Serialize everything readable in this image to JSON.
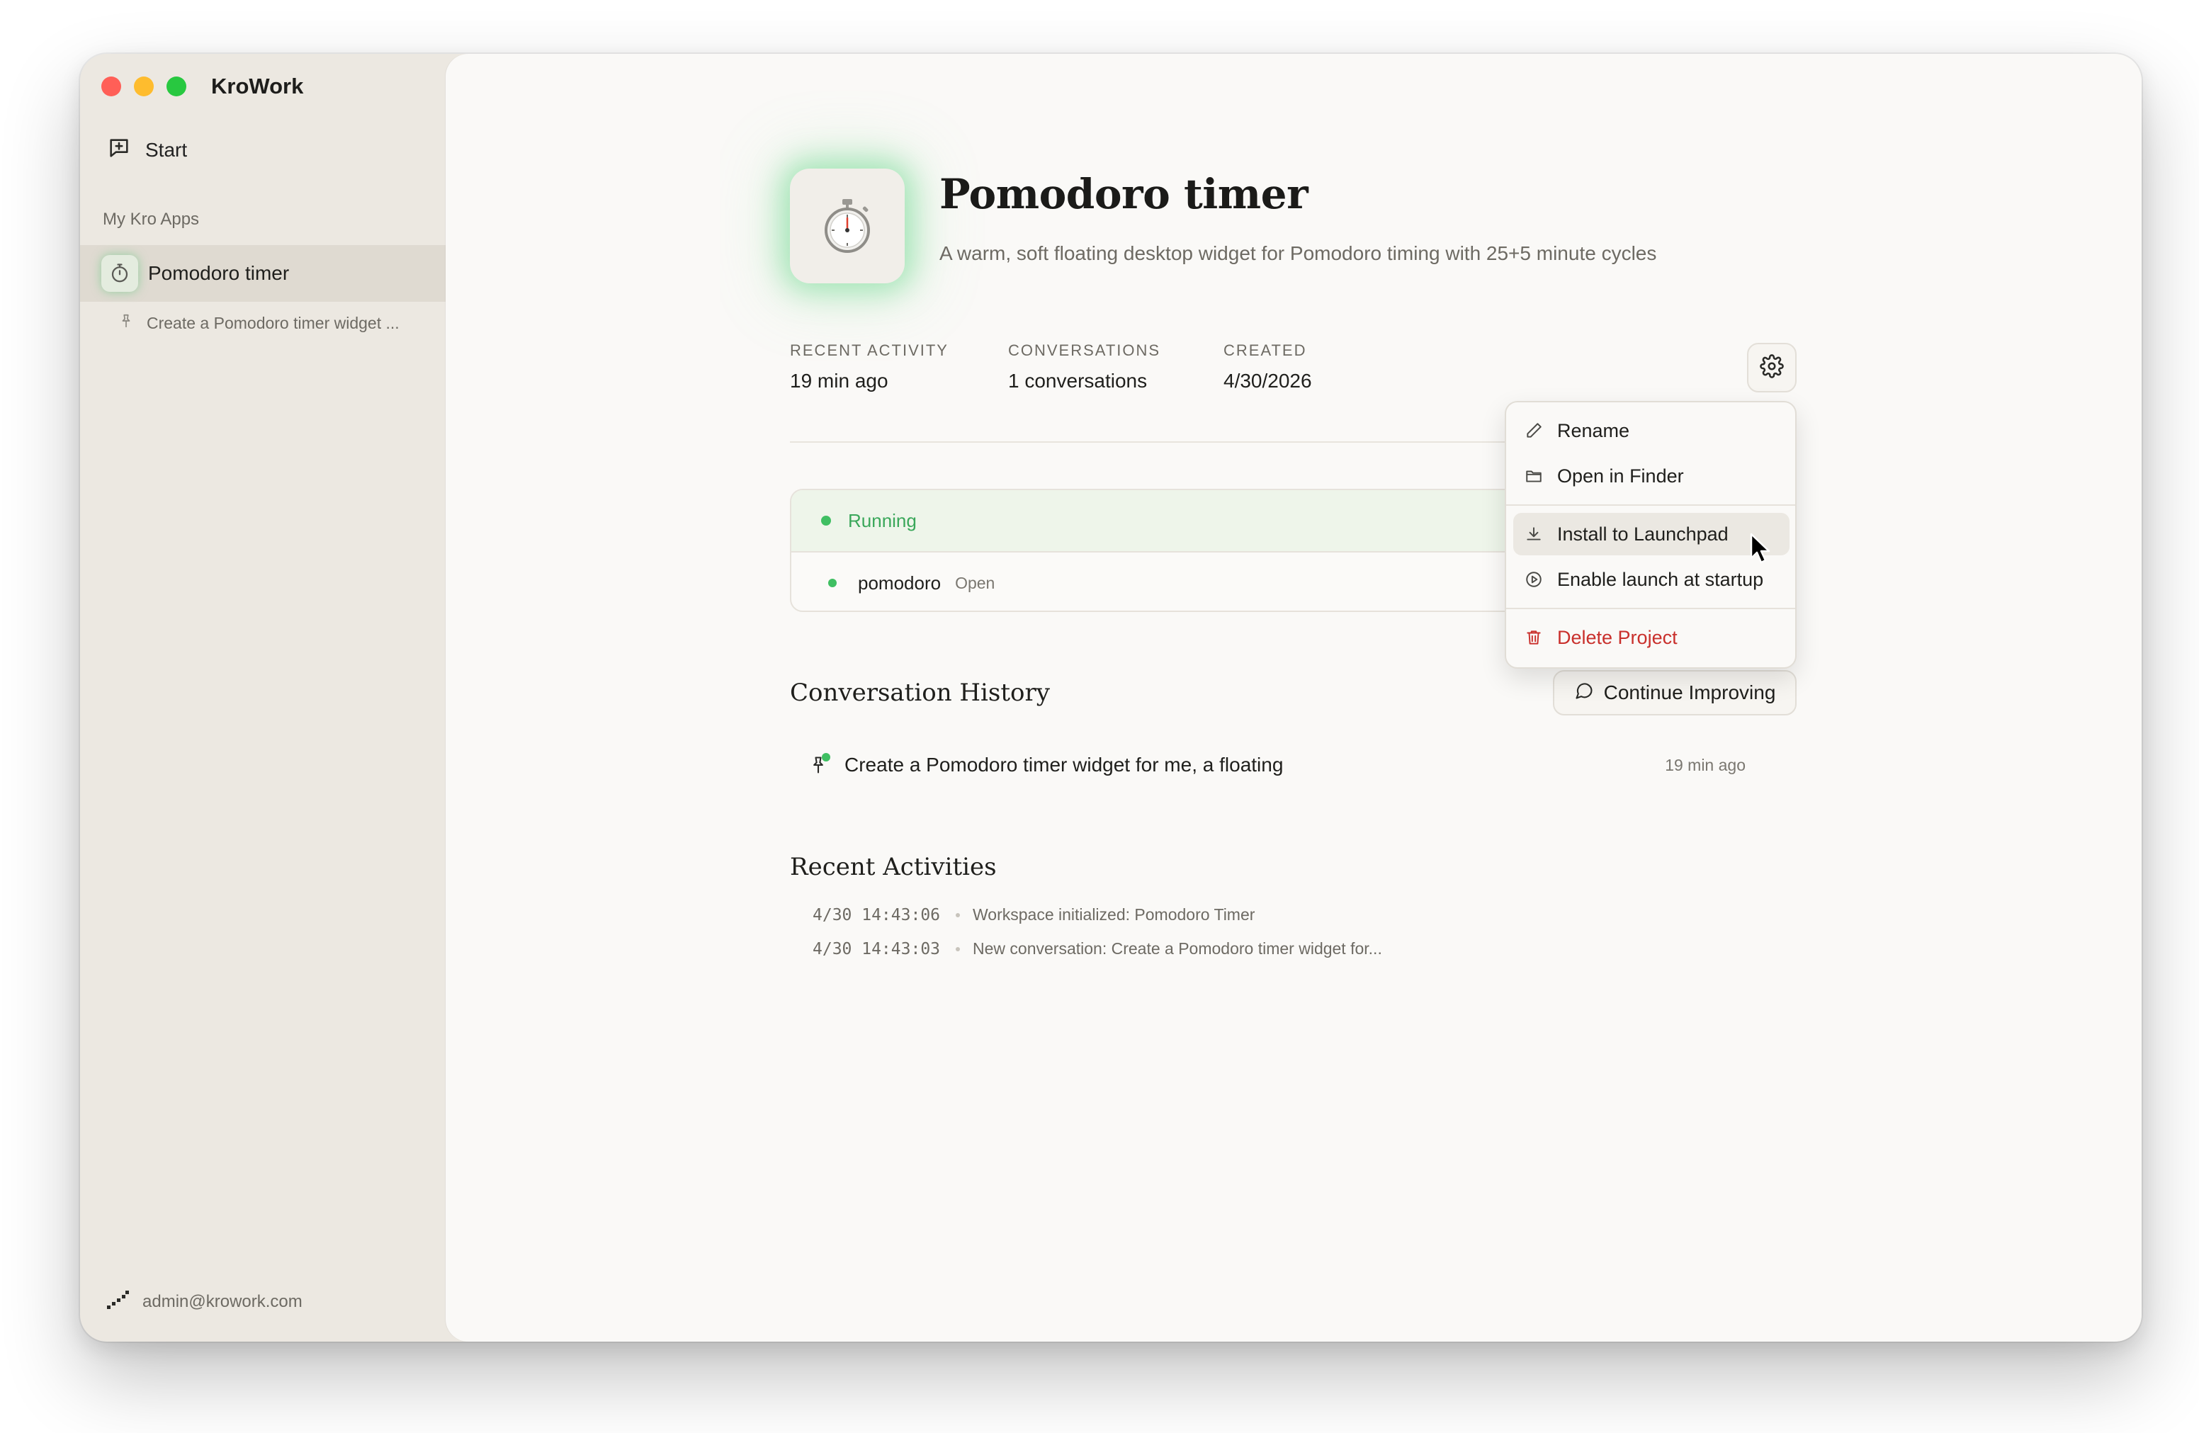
{
  "app": {
    "title": "KroWork"
  },
  "sidebar": {
    "start_label": "Start",
    "section_label": "My Kro Apps",
    "apps": [
      {
        "label": "Pomodoro timer"
      }
    ],
    "conversations": [
      {
        "label": "Create a Pomodoro timer widget ..."
      }
    ],
    "user_email": "admin@krowork.com"
  },
  "project": {
    "title": "Pomodoro timer",
    "description": "A warm, soft floating desktop widget for Pomodoro timing with 25+5 minute cycles",
    "stats": [
      {
        "label": "RECENT ACTIVITY",
        "value": "19 min ago"
      },
      {
        "label": "CONVERSATIONS",
        "value": "1 conversations"
      },
      {
        "label": "CREATED",
        "value": "4/30/2026"
      }
    ]
  },
  "status": {
    "label": "Running",
    "process": {
      "name": "pomodoro",
      "action": "Open"
    }
  },
  "conversation_history": {
    "title": "Conversation History",
    "continue_label": "Continue Improving",
    "items": [
      {
        "text": "Create a Pomodoro timer widget for me, a floating",
        "time": "19 min ago"
      }
    ]
  },
  "recent_activities": {
    "title": "Recent Activities",
    "items": [
      {
        "timestamp": "4/30 14:43:06",
        "text": "Workspace initialized: Pomodoro Timer"
      },
      {
        "timestamp": "4/30 14:43:03",
        "text": "New conversation: Create a Pomodoro timer widget for..."
      }
    ]
  },
  "menu": {
    "items": [
      {
        "label": "Rename",
        "icon": "pencil-icon"
      },
      {
        "label": "Open in Finder",
        "icon": "folder-icon"
      },
      {
        "label": "Install to Launchpad",
        "icon": "download-icon",
        "highlighted": true
      },
      {
        "label": "Enable launch at startup",
        "icon": "play-circle-icon"
      },
      {
        "label": "Delete Project",
        "icon": "trash-icon",
        "danger": true
      }
    ]
  },
  "colors": {
    "accent_green": "#3fbf62",
    "danger_red": "#c9302c",
    "sidebar_bg": "#ece8e1",
    "main_bg": "#faf9f7"
  }
}
